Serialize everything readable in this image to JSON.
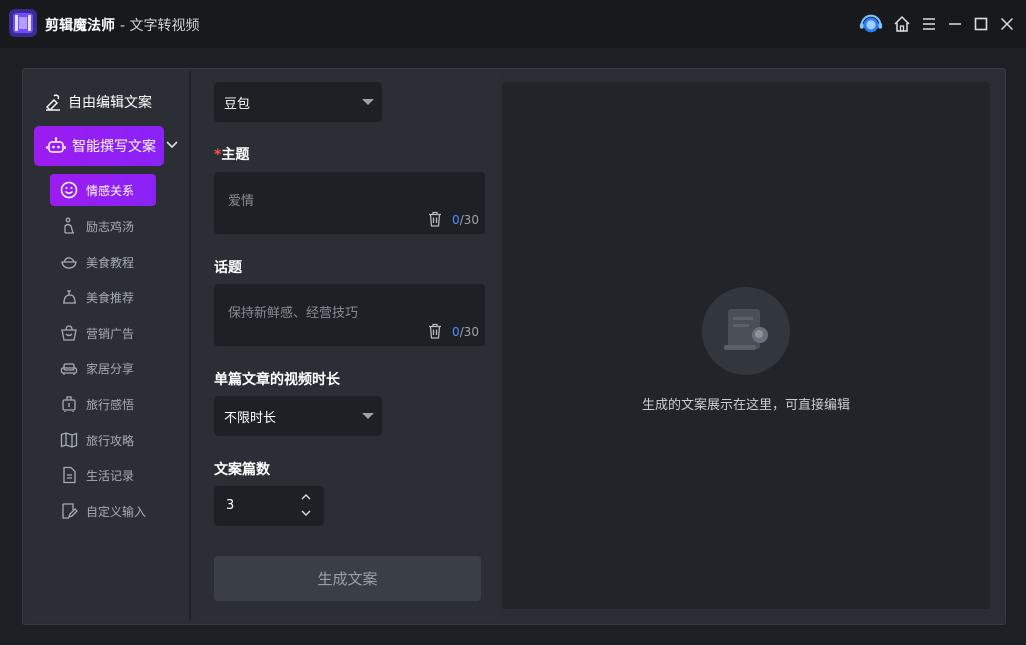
{
  "app": {
    "name": "剪辑魔法师",
    "subtitle": "- 文字转视频"
  },
  "window_controls": [
    "support-icon",
    "home-icon",
    "menu-icon",
    "minimize-icon",
    "maximize-icon",
    "close-icon"
  ],
  "sidebar": {
    "free_edit": "自由编辑文案",
    "ai_write": "智能撰写文案",
    "items": [
      {
        "label": "情感关系",
        "icon": "smile-icon",
        "active": true
      },
      {
        "label": "励志鸡汤",
        "icon": "runner-icon",
        "active": false
      },
      {
        "label": "美食教程",
        "icon": "bowl-icon",
        "active": false
      },
      {
        "label": "美食推荐",
        "icon": "chef-icon",
        "active": false
      },
      {
        "label": "营销广告",
        "icon": "basket-icon",
        "active": false
      },
      {
        "label": "家居分享",
        "icon": "sofa-icon",
        "active": false
      },
      {
        "label": "旅行感悟",
        "icon": "luggage-icon",
        "active": false
      },
      {
        "label": "旅行攻略",
        "icon": "map-icon",
        "active": false
      },
      {
        "label": "生活记录",
        "icon": "document-icon",
        "active": false
      },
      {
        "label": "自定义输入",
        "icon": "edit-icon",
        "active": false
      }
    ]
  },
  "form": {
    "model_select": "豆包",
    "theme": {
      "required_mark": "*",
      "label": "主题",
      "placeholder": "爱情",
      "count_current": "0",
      "count_max": "/30"
    },
    "topic": {
      "label": "话题",
      "placeholder": "保持新鲜感、经营技巧",
      "count_current": "0",
      "count_max": "/30"
    },
    "duration": {
      "label": "单篇文章的视频时长",
      "value": "不限时长"
    },
    "count": {
      "label": "文案篇数",
      "value": "3"
    },
    "generate_button": "生成文案"
  },
  "preview": {
    "empty_text": "生成的文案展示在这里，可直接编辑"
  },
  "colors": {
    "accent": "#9b1cf0",
    "link": "#4f8df7",
    "required": "#ff4d4f"
  }
}
